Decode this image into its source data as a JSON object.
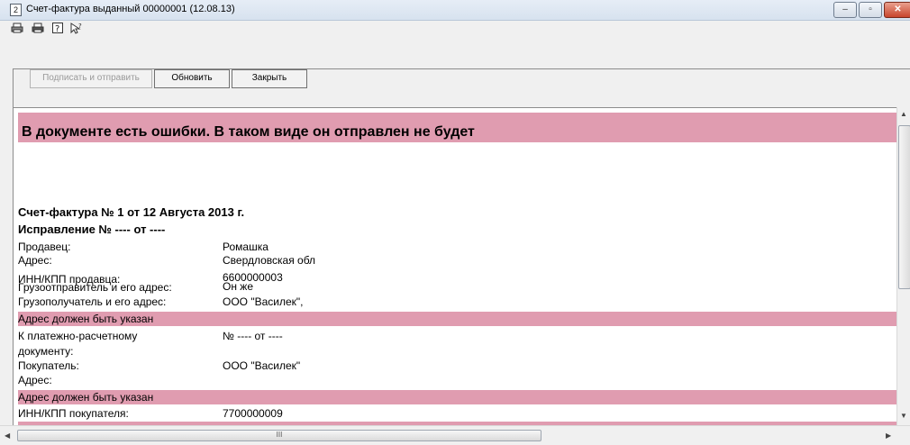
{
  "window": {
    "title": "Счет-фактура выданный 00000001 (12.08.13)",
    "title_icon_glyph": "2",
    "controls": {
      "minimize": "–",
      "maximize": "▫",
      "close": "✕"
    }
  },
  "toolbar_icons": [
    "print-icon",
    "print-preview-icon",
    "help-icon",
    "context-help-icon"
  ],
  "buttons": {
    "sign_send": "Подписать и отправить",
    "refresh": "Обновить",
    "close": "Закрыть"
  },
  "document": {
    "error_banner": "В документе есть ошибки. В таком виде он отправлен не будет",
    "heading": "Счет-фактура № 1 от 12 Августа 2013 г.",
    "correction": "Исправление № ---- от ----",
    "fields": [
      {
        "label": "Продавец:",
        "value": "Ромашка"
      },
      {
        "label": "Адрес:",
        "value": "Свердловская обл"
      },
      {
        "label": "ИНН/КПП продавца:",
        "value": "6600000003"
      },
      {
        "label": "Грузоотправитель и его адрес:",
        "value": "Он же"
      },
      {
        "label": "Грузополучатель и его адрес:",
        "value": "ООО \"Василек\","
      },
      {
        "label": "К платежно-расчетному",
        "label2": "документу:",
        "value": "№  ---- от ----"
      },
      {
        "label": "Покупатель:",
        "value": "ООО \"Василек\""
      },
      {
        "label": "Адрес:",
        "value": ""
      },
      {
        "label": "ИНН/КПП покупателя:",
        "value": "7700000009"
      }
    ],
    "warnings": [
      "Адрес должен быть указан",
      "Адрес должен быть указан"
    ],
    "highlight_color": "#e09cb0"
  },
  "scroll": {
    "thumb_glyph": "III"
  }
}
